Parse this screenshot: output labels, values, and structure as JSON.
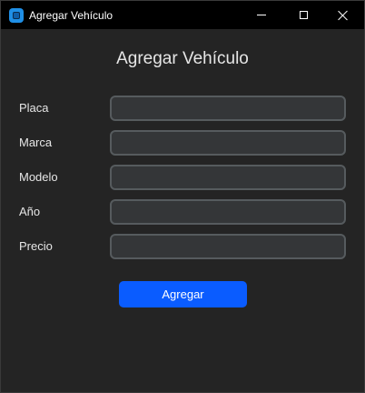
{
  "window": {
    "title": "Agregar Vehículo",
    "icon": "app-icon",
    "controls": [
      "minimize",
      "maximize",
      "close"
    ]
  },
  "form": {
    "title": "Agregar Vehículo",
    "fields": [
      {
        "label": "Placa",
        "value": ""
      },
      {
        "label": "Marca",
        "value": ""
      },
      {
        "label": "Modelo",
        "value": ""
      },
      {
        "label": "Año",
        "value": ""
      },
      {
        "label": "Precio",
        "value": ""
      }
    ],
    "submit_label": "Agregar"
  },
  "colors": {
    "background": "#242424",
    "titlebar": "#000000",
    "input_bg": "#343638",
    "input_border": "#565b5e",
    "accent": "#0a5cff"
  }
}
